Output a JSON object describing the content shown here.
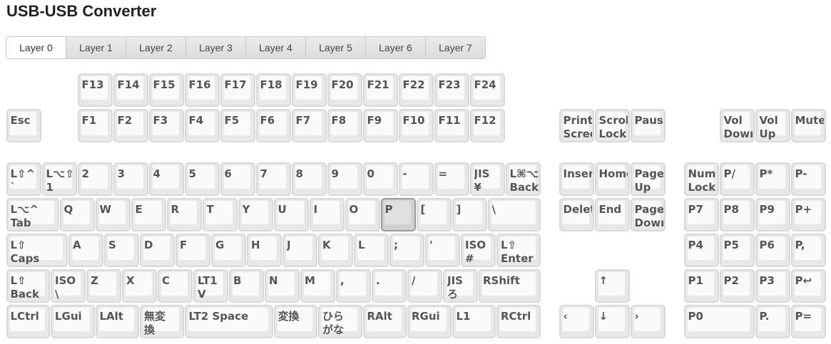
{
  "title": "USB-USB Converter",
  "tabs": [
    "Layer 0",
    "Layer 1",
    "Layer 2",
    "Layer 3",
    "Layer 4",
    "Layer 5",
    "Layer 6",
    "Layer 7"
  ],
  "active_tab": 0,
  "keys": [
    {
      "label": "F13"
    },
    {
      "label": "F14"
    },
    {
      "label": "F15"
    },
    {
      "label": "F16"
    },
    {
      "label": "F17"
    },
    {
      "label": "F18"
    },
    {
      "label": "F19"
    },
    {
      "label": "F20"
    },
    {
      "label": "F21"
    },
    {
      "label": "F22"
    },
    {
      "label": "F23"
    },
    {
      "label": "F24"
    },
    {
      "label": "Esc"
    },
    {
      "label": "F1"
    },
    {
      "label": "F2"
    },
    {
      "label": "F3"
    },
    {
      "label": "F4"
    },
    {
      "label": "F5"
    },
    {
      "label": "F6"
    },
    {
      "label": "F7"
    },
    {
      "label": "F8"
    },
    {
      "label": "F9"
    },
    {
      "label": "F10"
    },
    {
      "label": "F11"
    },
    {
      "label": "F12"
    },
    {
      "label": "Print\nScreen"
    },
    {
      "label": "Scroll\nLock"
    },
    {
      "label": "Pause"
    },
    {
      "label": "Vol\nDown"
    },
    {
      "label": "Vol\nUp"
    },
    {
      "label": "Mute"
    },
    {
      "label": "L⇧^\n`"
    },
    {
      "label": "L⌥⇧^\n1"
    },
    {
      "label": "2"
    },
    {
      "label": "3"
    },
    {
      "label": "4"
    },
    {
      "label": "5"
    },
    {
      "label": "6"
    },
    {
      "label": "7"
    },
    {
      "label": "8"
    },
    {
      "label": "9"
    },
    {
      "label": "0"
    },
    {
      "label": "-"
    },
    {
      "label": "="
    },
    {
      "label": "JIS\n¥"
    },
    {
      "label": "L⌘⌥\nBack"
    },
    {
      "label": "Insert"
    },
    {
      "label": "Home"
    },
    {
      "label": "Page\nUp"
    },
    {
      "label": "Num\nLock"
    },
    {
      "label": "P/"
    },
    {
      "label": "P*"
    },
    {
      "label": "P-"
    },
    {
      "label": "L⌥^\nTab"
    },
    {
      "label": "Q"
    },
    {
      "label": "W"
    },
    {
      "label": "E"
    },
    {
      "label": "R"
    },
    {
      "label": "T"
    },
    {
      "label": "Y"
    },
    {
      "label": "U"
    },
    {
      "label": "I"
    },
    {
      "label": "O"
    },
    {
      "label": "P",
      "selected": true
    },
    {
      "label": "["
    },
    {
      "label": "]"
    },
    {
      "label": "\\"
    },
    {
      "label": "Delete"
    },
    {
      "label": "End"
    },
    {
      "label": "Page\nDown"
    },
    {
      "label": "P7"
    },
    {
      "label": "P8"
    },
    {
      "label": "P9"
    },
    {
      "label": "P+"
    },
    {
      "label": "L⇧\nCaps"
    },
    {
      "label": "A"
    },
    {
      "label": "S"
    },
    {
      "label": "D"
    },
    {
      "label": "F"
    },
    {
      "label": "G"
    },
    {
      "label": "H"
    },
    {
      "label": "J"
    },
    {
      "label": "K"
    },
    {
      "label": "L"
    },
    {
      "label": ";"
    },
    {
      "label": "'"
    },
    {
      "label": "ISO\n#"
    },
    {
      "label": "L⇧\nEnter"
    },
    {
      "label": "P4"
    },
    {
      "label": "P5"
    },
    {
      "label": "P6"
    },
    {
      "label": "P,"
    },
    {
      "label": "L⇧\nBack"
    },
    {
      "label": "ISO\n\\"
    },
    {
      "label": "Z"
    },
    {
      "label": "X"
    },
    {
      "label": "C"
    },
    {
      "label": "LT1\nV"
    },
    {
      "label": "B"
    },
    {
      "label": "N"
    },
    {
      "label": "M"
    },
    {
      "label": ","
    },
    {
      "label": "."
    },
    {
      "label": "/"
    },
    {
      "label": "JIS\nろ"
    },
    {
      "label": "RShift"
    },
    {
      "label": "↑"
    },
    {
      "label": "P1"
    },
    {
      "label": "P2"
    },
    {
      "label": "P3"
    },
    {
      "label": "P↩"
    },
    {
      "label": "LCtrl"
    },
    {
      "label": "LGui"
    },
    {
      "label": "LAlt"
    },
    {
      "label": "無変\n換"
    },
    {
      "label": "LT2 Space"
    },
    {
      "label": "変換"
    },
    {
      "label": "ひら\nがな"
    },
    {
      "label": "RAlt"
    },
    {
      "label": "RGui"
    },
    {
      "label": "L1"
    },
    {
      "label": "RCtrl"
    },
    {
      "label": "‹"
    },
    {
      "label": "↓"
    },
    {
      "label": "›"
    },
    {
      "label": "P0"
    },
    {
      "label": "P."
    },
    {
      "label": "P="
    }
  ]
}
